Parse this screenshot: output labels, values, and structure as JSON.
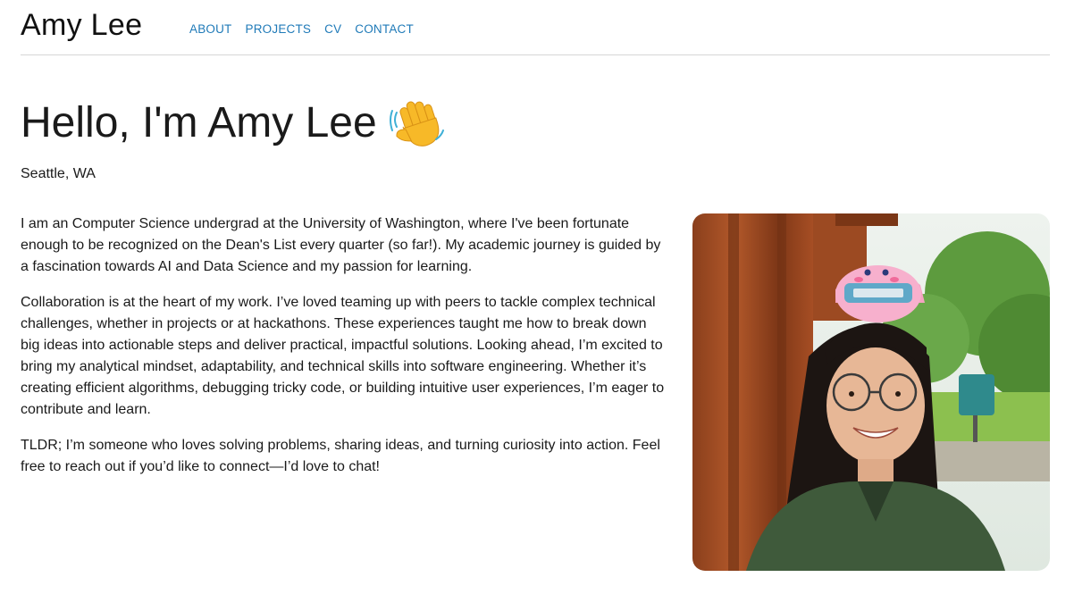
{
  "header": {
    "site_title": "Amy Lee",
    "nav": [
      "ABOUT",
      "PROJECTS",
      "CV",
      "CONTACT"
    ]
  },
  "intro": {
    "heading": "Hello, I'm Amy Lee",
    "location": "Seattle, WA",
    "paragraphs": [
      "I am an Computer Science undergrad at the University of Washington, where I've been fortunate enough to be recognized on the Dean's List every quarter (so far!). My academic journey is guided by a fascination towards AI and Data Science and my passion for learning.",
      "Collaboration is at the heart of my work. I’ve loved teaming up with peers to tackle complex technical challenges, whether in projects or at hackathons. These experiences taught me how to break down big ideas into actionable steps and deliver practical, impactful solutions. Looking ahead, I’m excited to bring my analytical mindset, adaptability, and technical skills into software engineering. Whether it’s creating efficient algorithms, debugging tricky code, or building intuitive user experiences, I’m eager to contribute and learn.",
      "TLDR; I’m someone who loves solving problems, sharing ideas, and turning curiosity into action. Feel free to reach out if you’d like to connect—I’d love to chat!"
    ]
  },
  "icons": {
    "wave": "waving-hand-icon"
  },
  "colors": {
    "link": "#1f7ab8",
    "text": "#1a1a1a",
    "divider": "#d6d6d6"
  }
}
